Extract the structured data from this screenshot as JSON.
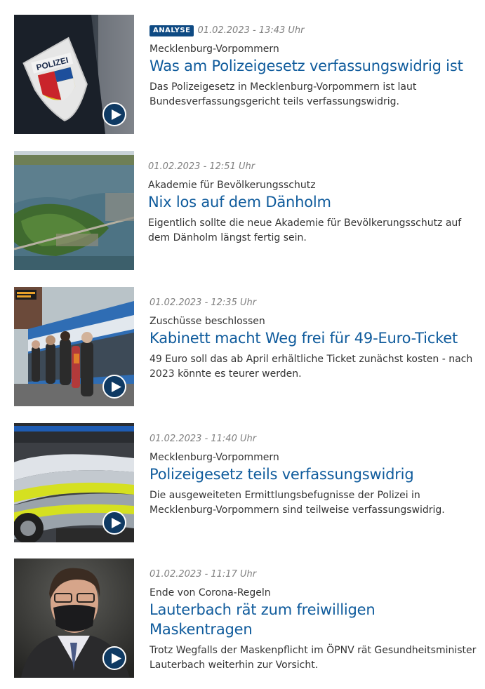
{
  "articles": [
    {
      "badge": "ANALYSE",
      "date": "01.02.2023 - 13:43 Uhr",
      "topline": "Mecklenburg-Vorpommern",
      "headline": "Was am Polizeigesetz verfassungswidrig ist",
      "text": "Das Polizeigesetz in Mecklenburg-Vorpommern ist laut Bundesverfassungsgericht teils verfassungswidrig.",
      "image_label": "POLIZEI",
      "has_video": true
    },
    {
      "date": "01.02.2023 - 12:51 Uhr",
      "topline": "Akademie für Bevölkerungsschutz",
      "headline": "Nix los auf dem Dänholm",
      "text": "Eigentlich sollte die neue Akademie für Bevölkerungsschutz auf dem Dänholm längst fertig sein.",
      "has_video": false
    },
    {
      "date": "01.02.2023 - 12:35 Uhr",
      "topline": "Zuschüsse beschlossen",
      "headline": "Kabinett macht Weg frei für 49-Euro-Ticket",
      "text": "49 Euro soll das ab April erhältliche Ticket zunächst kosten - nach 2023 könnte es teurer werden.",
      "has_video": true
    },
    {
      "date": "01.02.2023 - 11:40 Uhr",
      "topline": "Mecklenburg-Vorpommern",
      "headline": "Polizeigesetz teils verfassungswidrig",
      "text": "Die ausgeweiteten Ermittlungsbefugnisse der Polizei in Mecklenburg-Vorpommern sind teilweise verfassungswidrig.",
      "has_video": true
    },
    {
      "date": "01.02.2023 - 11:17 Uhr",
      "topline": "Ende von Corona-Regeln",
      "headline": "Lauterbach rät zum freiwilligen Maskentragen",
      "text": "Trotz Wegfalls der Maskenpflicht im ÖPNV rät Gesundheitsminister Lauterbach weiterhin zur Vorsicht.",
      "has_video": true
    }
  ],
  "colors": {
    "headline": "#0f5b9c",
    "badge": "#0e4a83",
    "date": "#808080",
    "text": "#333333",
    "play_button": "#0f3a63"
  },
  "icons": {
    "video": "play-icon"
  }
}
